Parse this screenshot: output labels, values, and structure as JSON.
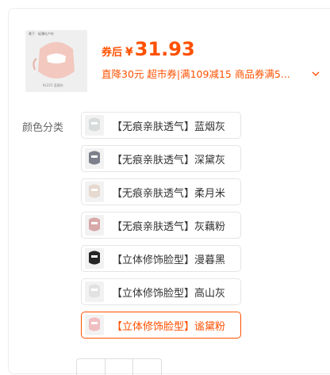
{
  "product": {
    "thumbnail_brand": "蕉下 · 轻薄礼户外",
    "thumbnail_caption": "KL225 蓝烟灰",
    "price_prefix": "券后",
    "currency": "¥",
    "price": "31.93",
    "promo_text": "直降30元 超市券|满109减15 商品券满5..."
  },
  "colors": {
    "accent": "#ff5000",
    "label": "颜色分类",
    "options": [
      {
        "label": "【无痕亲肤透气】蓝烟灰",
        "swatch": "#d9dcdc",
        "selected": false
      },
      {
        "label": "【无痕亲肤透气】深黛灰",
        "swatch": "#7d7f8c",
        "selected": false
      },
      {
        "label": "【无痕亲肤透气】柔月米",
        "swatch": "#e6d9d0",
        "selected": false
      },
      {
        "label": "【无痕亲肤透气】灰藕粉",
        "swatch": "#d8a9a9",
        "selected": false
      },
      {
        "label": "【立体修饰脸型】漫暮黑",
        "swatch": "#262626",
        "selected": false
      },
      {
        "label": "【立体修饰脸型】高山灰",
        "swatch": "#e2e2e2",
        "selected": false
      },
      {
        "label": "【立体修饰脸型】谧黛粉",
        "swatch": "#f0bfc2",
        "selected": true
      }
    ]
  }
}
